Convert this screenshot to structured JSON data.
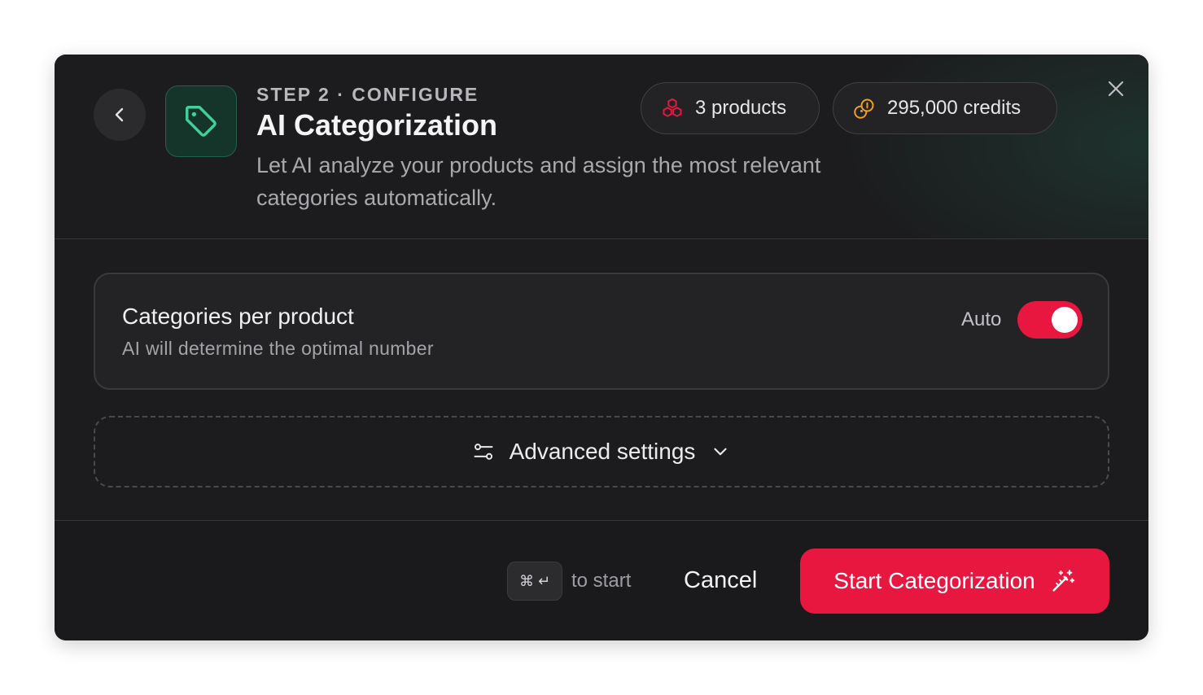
{
  "header": {
    "step": "STEP 2 · CONFIGURE",
    "title": "AI Categorization",
    "description": "Let AI analyze your products and assign the most relevant categories automatically.",
    "products_pill": "3 products",
    "credits_pill": "295,000 credits"
  },
  "settings": {
    "categories_title": "Categories per product",
    "categories_subtitle": "AI will determine the optimal number",
    "auto_label": "Auto",
    "auto_enabled": true,
    "advanced_label": "Advanced settings"
  },
  "footer": {
    "shortcut_keys": "⌘ ↵",
    "shortcut_hint": "to start",
    "cancel_label": "Cancel",
    "start_label": "Start Categorization"
  },
  "colors": {
    "accent": "#e8173f",
    "tag_green": "#3fd19a",
    "credits_orange": "#f0a020",
    "background": "#1c1c1e"
  },
  "icons": [
    "chevron-left-icon",
    "tag-icon",
    "cubes-icon",
    "coins-icon",
    "close-icon",
    "sliders-icon",
    "chevron-down-icon",
    "magic-wand-icon"
  ]
}
